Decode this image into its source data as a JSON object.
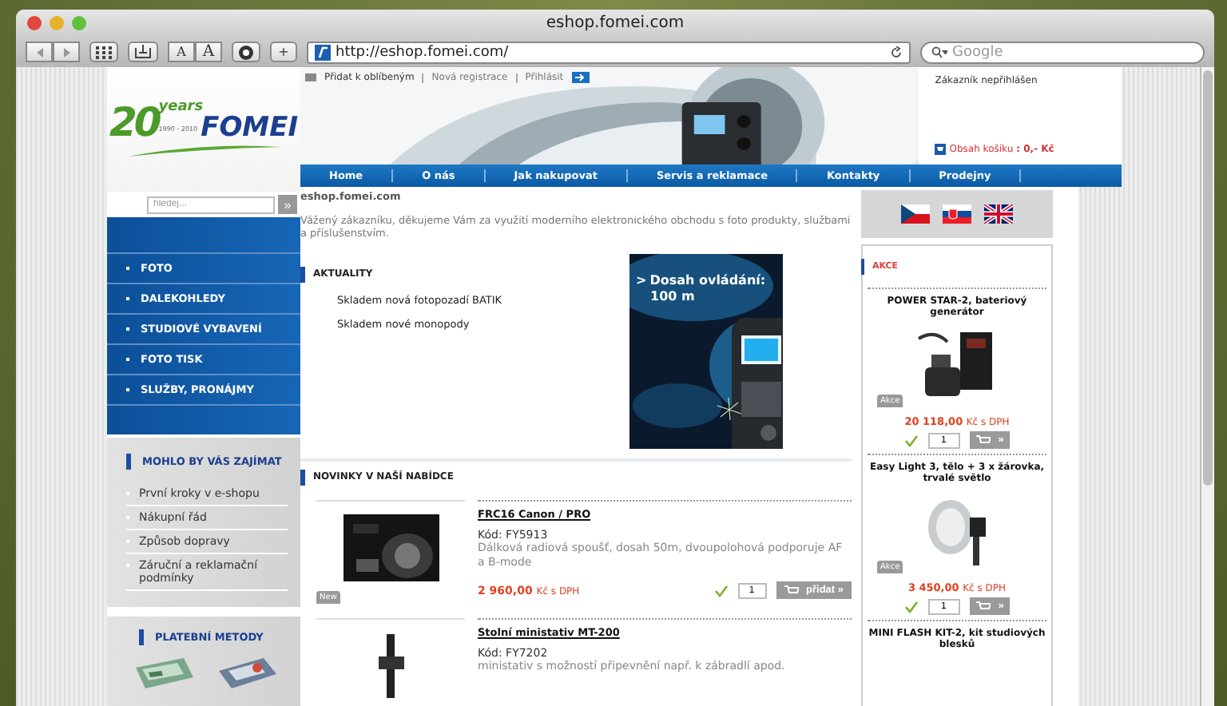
{
  "browser": {
    "title": "eshop.fomei.com",
    "text_size_buttons": [
      "A",
      "A"
    ],
    "add_button": "+",
    "url": "http://eshop.fomei.com/",
    "search_placeholder": "Google"
  },
  "logo": {
    "number": "20",
    "years": "years",
    "brand": "FOMEI",
    "span": "1990 - 2010"
  },
  "search": {
    "placeholder": "hledej...",
    "button": "»"
  },
  "categories": [
    "FOTO",
    "DALEKOHLEDY",
    "STUDIOVÉ VYBAVENÍ",
    "FOTO TISK",
    "SLUŽBY, PRONÁJMY"
  ],
  "interest": {
    "title": "MOHLO BY VÁS ZAJÍMAT",
    "items": [
      "První kroky v e-shopu",
      "Nákupní řád",
      "Způsob dopravy",
      "Záruční a reklamační podmínky"
    ]
  },
  "payment": {
    "title": "PLATEBNÍ METODY"
  },
  "top_links": [
    "Přidat k oblíbeným",
    "Nová registrace",
    "Přihlásit"
  ],
  "nav": [
    "Home",
    "O nás",
    "Jak nakupovat",
    "Servis a reklamace",
    "Kontakty",
    "Prodejny"
  ],
  "customer": {
    "status": "Zákazník nepřihlášen",
    "cart_label": "Obsah košíku",
    "cart_value": ": 0,- Kč"
  },
  "breadcrumb": "eshop.fomei.com",
  "welcome": "Vážený zákazníku, děkujeme Vám za využití moderního elektronického obchodu s foto produkty, službami a příslušenstvím.",
  "news": {
    "title": "AKTUALITY",
    "items": [
      "Skladem nová fotopozadí BATIK",
      "Skladem nové monopody"
    ]
  },
  "banner": {
    "marker": ">",
    "lines": [
      "Dosah ovládání:",
      "100 m"
    ]
  },
  "new_products": {
    "title": "NOVINKY V NAŠÍ NABÍDCE",
    "items": [
      {
        "name": "FRC16 Canon / PRO",
        "code": "Kód: FY5913",
        "description": "Dálková radiová spoušť, dosah 50m, dvoupolohová podporuje AF a B-mode",
        "badge": "New",
        "price": "2 960,00",
        "currency": "Kč s DPH",
        "in_stock": true,
        "quantity": "1",
        "button": "přidat »"
      },
      {
        "name": "Stolní ministativ MT-200",
        "code": "Kód: FY7202",
        "description": "ministativ s možností připevnění např. k zábradlí apod."
      }
    ]
  },
  "flags": [
    {
      "kind": "cz"
    },
    {
      "kind": "sk"
    },
    {
      "kind": "gb"
    }
  ],
  "promo": {
    "title": "AKCE",
    "items": [
      {
        "name": "POWER STAR-2, bateriový generátor",
        "badge": "Akce",
        "price": "20 118,00",
        "currency": "Kč s DPH",
        "in_stock": true,
        "quantity": "1",
        "button": "»"
      },
      {
        "name": "Easy Light 3, tělo + 3 x žárovka, trvalé světlo",
        "badge": "Akce",
        "price": "3 450,00",
        "currency": "Kč s DPH",
        "in_stock": true,
        "quantity": "1",
        "button": "»"
      },
      {
        "name": "MINI FLASH KIT-2, kit studiových blesků"
      }
    ]
  }
}
